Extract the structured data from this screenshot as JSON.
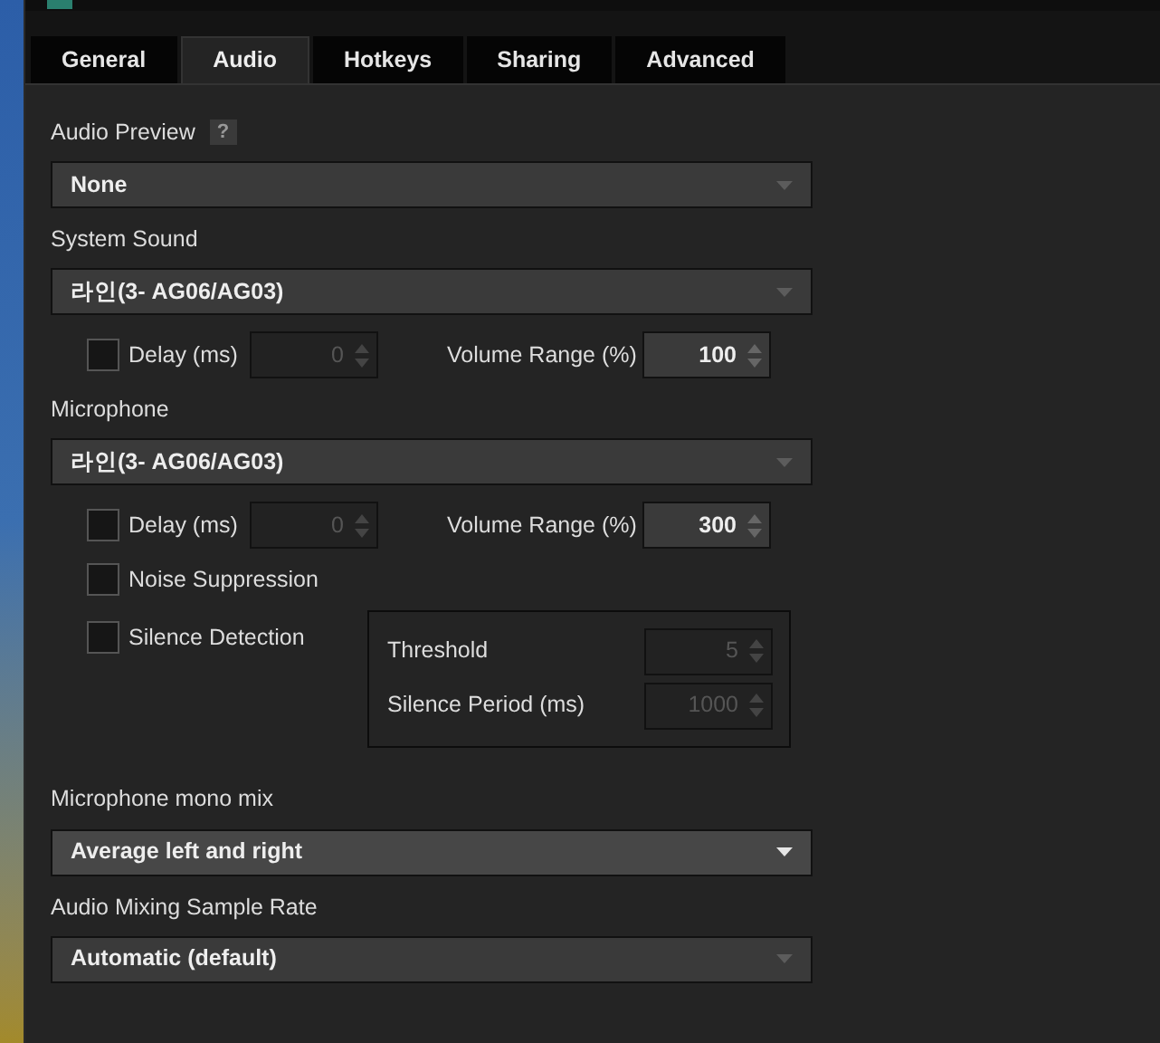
{
  "tabs": [
    {
      "label": "General",
      "selected": false
    },
    {
      "label": "Audio",
      "selected": true
    },
    {
      "label": "Hotkeys",
      "selected": false
    },
    {
      "label": "Sharing",
      "selected": false
    },
    {
      "label": "Advanced",
      "selected": false
    }
  ],
  "audio_preview": {
    "label": "Audio Preview",
    "help": "?",
    "dropdown": {
      "value": "None",
      "focused": false
    }
  },
  "system_sound": {
    "label": "System Sound",
    "dropdown": {
      "value": "라인(3- AG06/AG03)",
      "focused": false
    },
    "delay": {
      "label": "Delay (ms)",
      "checked": false,
      "value": "0",
      "disabled": true
    },
    "volume": {
      "label": "Volume Range (%)",
      "value": "100",
      "disabled": false
    }
  },
  "microphone": {
    "label": "Microphone",
    "dropdown": {
      "value": "라인(3- AG06/AG03)",
      "focused": false
    },
    "delay": {
      "label": "Delay (ms)",
      "checked": false,
      "value": "0",
      "disabled": true
    },
    "volume": {
      "label": "Volume Range (%)",
      "value": "300",
      "disabled": false
    },
    "noise_suppression": {
      "label": "Noise Suppression",
      "checked": false
    },
    "silence_detection": {
      "label": "Silence Detection",
      "checked": false,
      "threshold": {
        "label": "Threshold",
        "value": "5",
        "disabled": true
      },
      "period": {
        "label": "Silence Period (ms)",
        "value": "1000",
        "disabled": true
      }
    }
  },
  "mono_mix": {
    "label": "Microphone mono mix",
    "dropdown": {
      "value": "Average left and right",
      "focused": true
    }
  },
  "sample_rate": {
    "label": "Audio Mixing Sample Rate",
    "dropdown": {
      "value": "Automatic (default)",
      "focused": false
    }
  }
}
